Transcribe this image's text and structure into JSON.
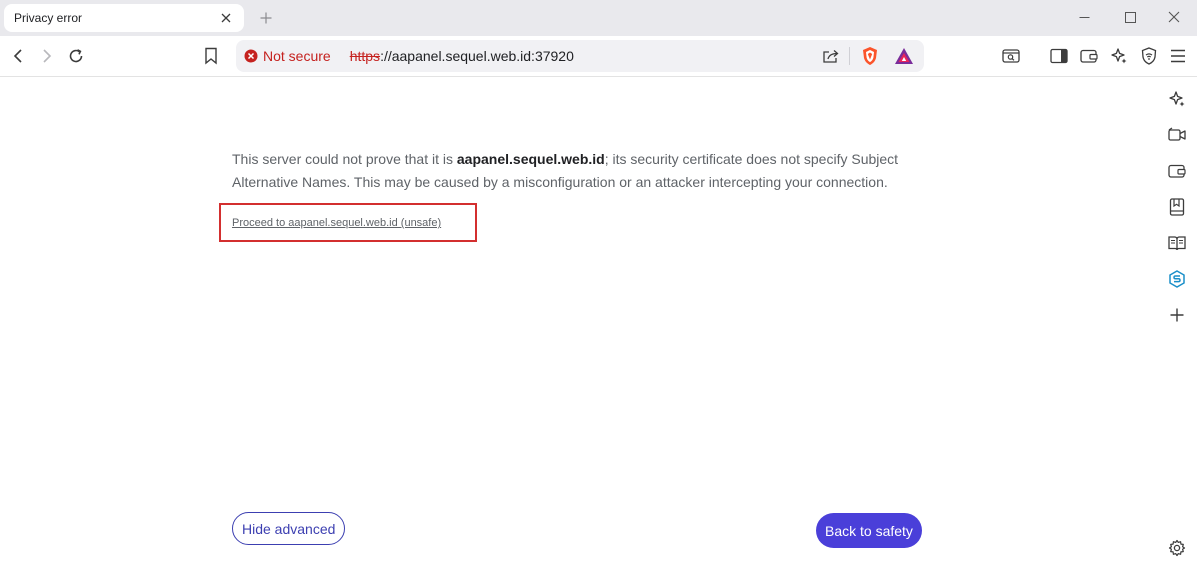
{
  "tab": {
    "title": "Privacy error"
  },
  "toolbar": {
    "security_label": "Not secure",
    "url_scheme": "https",
    "url_rest": "://aapanel.sequel.web.id:37920"
  },
  "page": {
    "text_before": "This server could not prove that it is ",
    "domain": "aapanel.sequel.web.id",
    "text_after": "; its security certificate does not specify Subject Alternative Names. This may be caused by a misconfiguration or an attacker intercepting your connection.",
    "proceed_link": "Proceed to aapanel.sequel.web.id (unsafe)",
    "hide_advanced": "Hide advanced",
    "back_to_safety": "Back to safety"
  },
  "colors": {
    "accent": "#4a3fd9",
    "danger": "#c5221f",
    "highlight_box": "#d32f2f",
    "brave_orange": "#fb542b"
  },
  "icons": {
    "toolbar": [
      "back-icon",
      "forward-icon",
      "reload-icon",
      "bookmark-icon",
      "share-icon",
      "brave-shields-icon",
      "brave-rewards-icon",
      "tab-search-icon",
      "sidebar-toggle-icon",
      "wallet-icon",
      "leo-ai-icon",
      "vpn-icon",
      "menu-icon"
    ],
    "sidebar": [
      "leo-ai-icon",
      "talk-icon",
      "wallet-icon",
      "bookmarks-icon",
      "reading-list-icon",
      "sequel-icon",
      "add-icon",
      "settings-icon"
    ]
  }
}
